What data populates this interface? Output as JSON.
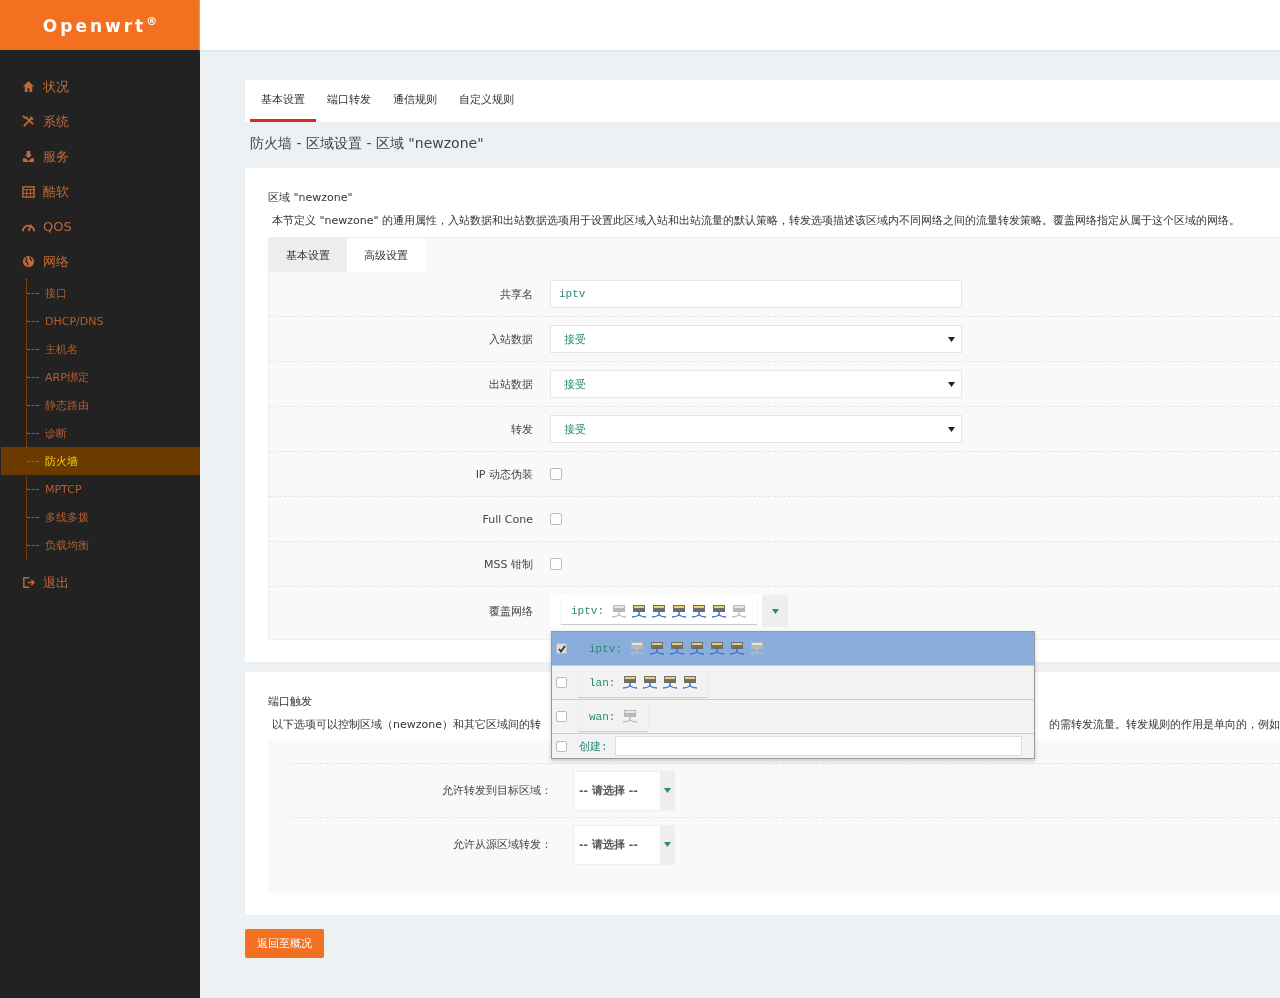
{
  "brand": {
    "name": "Openwrt",
    "mark": "®"
  },
  "sidebar": {
    "items": [
      {
        "label": "状况",
        "kind": "home",
        "selected": false
      },
      {
        "label": "系统",
        "kind": "tools",
        "selected": false
      },
      {
        "label": "服务",
        "kind": "download",
        "selected": false
      },
      {
        "label": "酷软",
        "kind": "calendar",
        "selected": false
      },
      {
        "label": "QOS",
        "kind": "gauge",
        "selected": false
      },
      {
        "label": "网络",
        "kind": "globe",
        "selected": false,
        "children": [
          {
            "label": "接口",
            "selected": false
          },
          {
            "label": "DHCP/DNS",
            "selected": false
          },
          {
            "label": "主机名",
            "selected": false
          },
          {
            "label": "ARP绑定",
            "selected": false
          },
          {
            "label": "静态路由",
            "selected": false
          },
          {
            "label": "诊断",
            "selected": false
          },
          {
            "label": "防火墙",
            "selected": true
          },
          {
            "label": "MPTCP",
            "selected": false
          },
          {
            "label": "多线多拨",
            "selected": false
          },
          {
            "label": "负载均衡",
            "selected": false
          }
        ]
      },
      {
        "label": "退出",
        "kind": "logout",
        "selected": false
      }
    ]
  },
  "tabs": [
    {
      "label": "基本设置",
      "selected": true
    },
    {
      "label": "端口转发",
      "selected": false
    },
    {
      "label": "通信规则",
      "selected": false
    },
    {
      "label": "自定义规则",
      "selected": false
    }
  ],
  "page_title": "防火墙 - 区域设置 - 区域 \"newzone\"",
  "zone_section": {
    "title": "区域 \"newzone\"",
    "description": "本节定义 \"newzone\" 的通用属性，入站数据和出站数据选项用于设置此区域入站和出站流量的默认策略，转发选项描述该区域内不同网络之间的流量转发策略。覆盖网络指定从属于这个区域的网络。",
    "tabs": [
      {
        "label": "基本设置",
        "selected": true
      },
      {
        "label": "高级设置",
        "selected": false
      }
    ],
    "fields": [
      {
        "kind": "text",
        "label": "共享名",
        "value": "iptv"
      },
      {
        "kind": "select",
        "label": "入站数据",
        "value": "接受"
      },
      {
        "kind": "select",
        "label": "出站数据",
        "value": "接受"
      },
      {
        "kind": "select",
        "label": "转发",
        "value": "接受"
      },
      {
        "kind": "checkbox",
        "label": "IP 动态伪装",
        "checked": false
      },
      {
        "kind": "checkbox",
        "label": "Full Cone",
        "checked": false
      },
      {
        "kind": "checkbox",
        "label": "MSS 钳制",
        "checked": false
      },
      {
        "kind": "networks",
        "label": "覆盖网络",
        "value": "iptv:",
        "ports": [
          {
            "active": false
          },
          {
            "active": true
          },
          {
            "active": true
          },
          {
            "active": true
          },
          {
            "active": true
          },
          {
            "active": true
          },
          {
            "active": false
          }
        ]
      }
    ]
  },
  "network_dropdown": {
    "options": [
      {
        "label": "iptv:",
        "selected": true,
        "ports": [
          {
            "active": false
          },
          {
            "active": true
          },
          {
            "active": true
          },
          {
            "active": true
          },
          {
            "active": true
          },
          {
            "active": true
          },
          {
            "active": false
          }
        ]
      },
      {
        "label": "lan:",
        "selected": false,
        "ports": [
          {
            "active": true
          },
          {
            "active": true
          },
          {
            "active": true
          },
          {
            "active": true
          }
        ]
      },
      {
        "label": "wan:",
        "selected": false,
        "ports": [
          {
            "active": false
          }
        ]
      }
    ],
    "create": {
      "label": "创建:",
      "checked": false
    }
  },
  "forward_section": {
    "title": "端口触发",
    "description_left": "以下选项可以控制区域（newzone）和其它区域间的转",
    "description_right": "的需转发流量。转发规则的作用是单向的，例如",
    "fields": [
      {
        "label": "允许转发到目标区域：",
        "value": "-- 请选择 --"
      },
      {
        "label": "允许从源区域转发：",
        "value": "-- 请选择 --"
      }
    ]
  },
  "back_button": "返回至概况"
}
